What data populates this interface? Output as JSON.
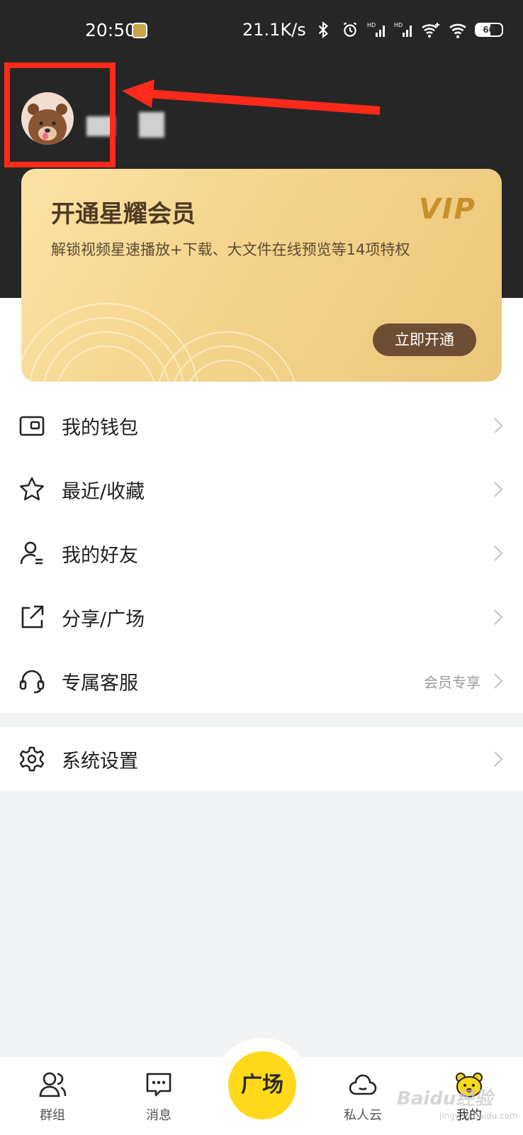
{
  "status_bar": {
    "time": "20:50",
    "speed": "21.1K/s",
    "battery": "60"
  },
  "profile": {
    "avatar_icon": "bear-avatar-icon"
  },
  "vip_card": {
    "title": "开通星耀会员",
    "logo": "VIP",
    "subtitle": "解锁视频星速播放+下载、大文件在线预览等14项特权",
    "button": "立即开通"
  },
  "menu": {
    "items": [
      {
        "label": "我的钱包",
        "icon": "wallet-icon",
        "extra": ""
      },
      {
        "label": "最近/收藏",
        "icon": "star-icon",
        "extra": ""
      },
      {
        "label": "我的好友",
        "icon": "friend-icon",
        "extra": ""
      },
      {
        "label": "分享/广场",
        "icon": "share-icon",
        "extra": ""
      },
      {
        "label": "专属客服",
        "icon": "headset-icon",
        "extra": "会员专享"
      }
    ],
    "settings": {
      "label": "系统设置",
      "icon": "gear-icon"
    }
  },
  "bottom_nav": {
    "items": [
      {
        "label": "群组",
        "icon": "group-icon"
      },
      {
        "label": "消息",
        "icon": "message-icon"
      },
      {
        "label": "私人云",
        "icon": "cloud-icon"
      },
      {
        "label": "我的",
        "icon": "bear-icon"
      }
    ],
    "center": "广场"
  },
  "watermark": {
    "text": "Baidu经验",
    "sub": "jingyan.baidu.com"
  },
  "colors": {
    "header_bg": "#262626",
    "accent_yellow": "#ffd91a",
    "vip_button": "#6d4d33",
    "annotation_red": "#ff2a1a"
  }
}
